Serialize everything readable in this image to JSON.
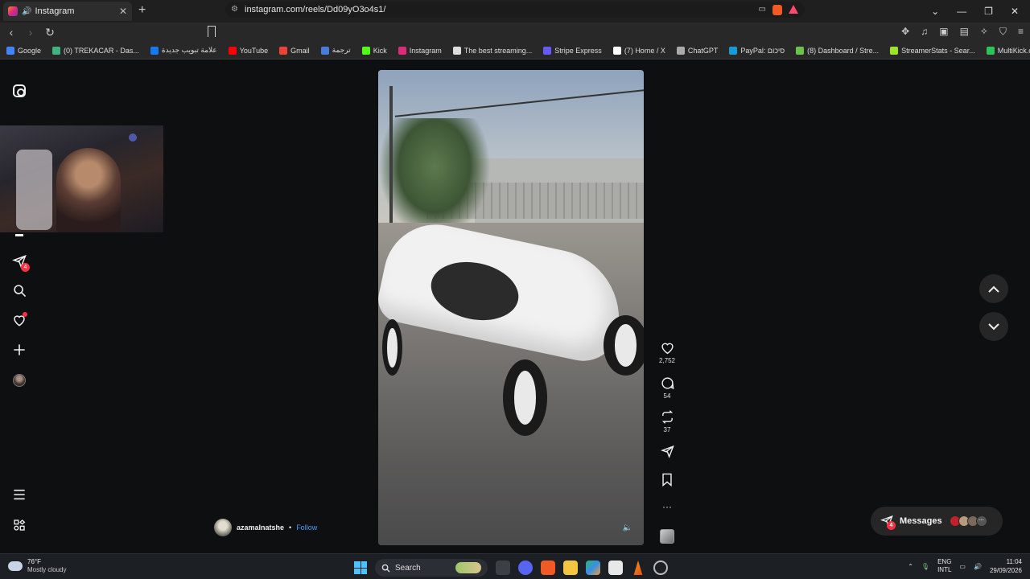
{
  "browser": {
    "tab_title": "Instagram",
    "tab_audio_icon": "speaker-icon",
    "url": "instagram.com/reels/Dd09yO3o4s1/",
    "window_controls": [
      "⌄",
      "—",
      "❐",
      "✕"
    ]
  },
  "bookmarks": [
    {
      "label": "Google",
      "color": "#4285f4"
    },
    {
      "label": "(0) TREKACAR - Das...",
      "color": "#3fb27f"
    },
    {
      "label": "علامة تبويب جديدة",
      "color": "#1877f2"
    },
    {
      "label": "YouTube",
      "color": "#ff0000"
    },
    {
      "label": "Gmail",
      "color": "#ea4335"
    },
    {
      "label": "ترجمة",
      "color": "#4a7bd8"
    },
    {
      "label": "Kick",
      "color": "#53fc18"
    },
    {
      "label": "Instagram",
      "color": "#dd2a7b"
    },
    {
      "label": "The best streaming...",
      "color": "#dddddd"
    },
    {
      "label": "Stripe Express",
      "color": "#635bff"
    },
    {
      "label": "(7) Home / X",
      "color": "#ffffff"
    },
    {
      "label": "ChatGPT",
      "color": "#aaaaaa"
    },
    {
      "label": "PayPal: סיכום",
      "color": "#179bd7"
    },
    {
      "label": "(8) Dashboard / Stre...",
      "color": "#6cc24a"
    },
    {
      "label": "StreamerStats - Sear...",
      "color": "#9be22b"
    },
    {
      "label": "MultiKick.com: Watc...",
      "color": "#30c25a"
    }
  ],
  "sidebar": {
    "messages_badge": "4"
  },
  "reel": {
    "likes": "2,752",
    "comments": "54",
    "reposts": "37",
    "author": "azamalnatshe",
    "separator": "•",
    "follow_label": "Follow"
  },
  "messages": {
    "label": "Messages",
    "badge": "4",
    "more": "···"
  },
  "taskbar": {
    "temp": "76°F",
    "condition": "Mostly cloudy",
    "search_placeholder": "Search",
    "lang1": "ENG",
    "lang2": "INTL",
    "time": "11:04",
    "date": "29/09/2026"
  }
}
